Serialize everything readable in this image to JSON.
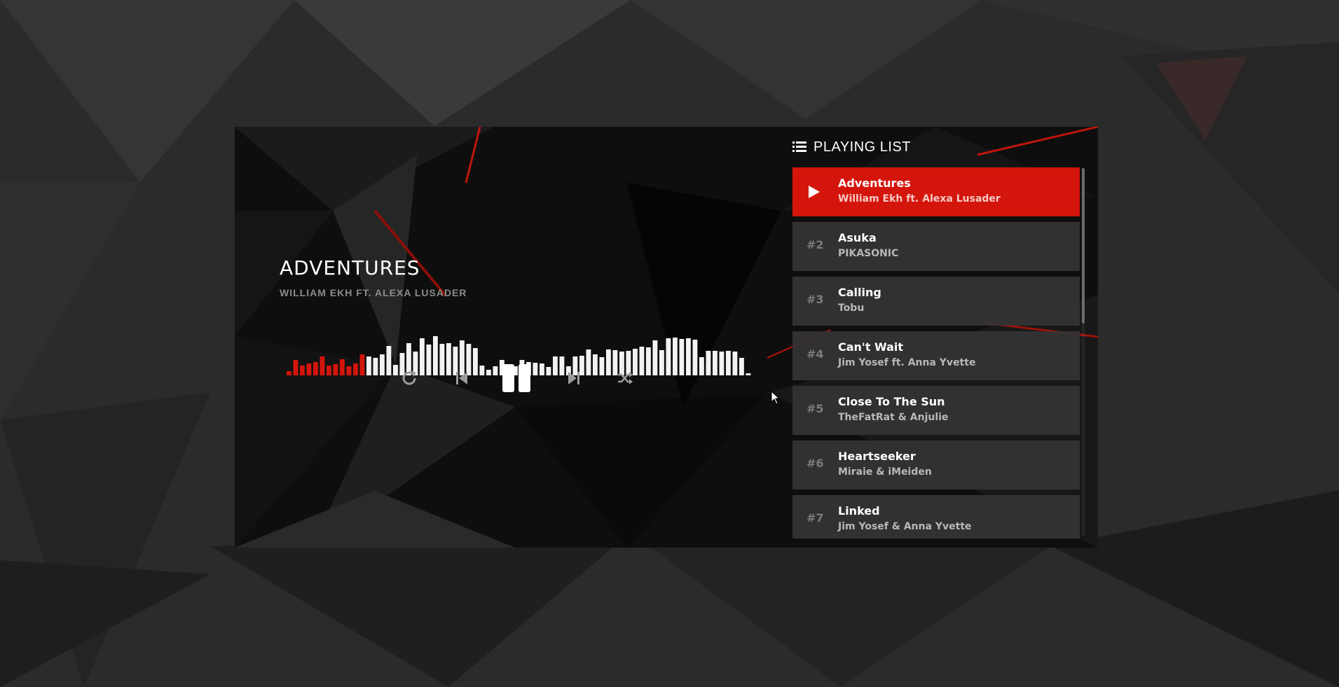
{
  "now_playing": {
    "title": "ADVENTURES",
    "artist": "WILLIAM EKH FT. ALEXA LUSADER",
    "progress": 0.17
  },
  "visualizer": {
    "levels": [
      6,
      22,
      14,
      17,
      19,
      27,
      14,
      16,
      23,
      13,
      17,
      30,
      27,
      25,
      30,
      42,
      15,
      32,
      46,
      34,
      53,
      44,
      56,
      45,
      46,
      41,
      50,
      45,
      39,
      14,
      8,
      13,
      22,
      12,
      13,
      22,
      19,
      18,
      17,
      12,
      27,
      27,
      13,
      27,
      28,
      37,
      30,
      26,
      37,
      36,
      34,
      35,
      38,
      41,
      40,
      50,
      36,
      53,
      54,
      52,
      53,
      51,
      26,
      35,
      35,
      34,
      35,
      34,
      25,
      3
    ],
    "played_color": "#d4150c",
    "unplayed_color": "#f2f2f2"
  },
  "controls": {
    "repeat_icon": "repeat-icon",
    "prev_icon": "skip-back-icon",
    "pause_icon": "pause-icon",
    "next_icon": "skip-forward-icon",
    "shuffle_icon": "shuffle-icon"
  },
  "playlist": {
    "heading": "PLAYING LIST",
    "heading_icon": "list-icon",
    "items": [
      {
        "number": "",
        "name": "Adventures",
        "artist": "William Ekh ft. Alexa Lusader",
        "active": true
      },
      {
        "number": "#2",
        "name": "Asuka",
        "artist": "PIKASONIC",
        "active": false
      },
      {
        "number": "#3",
        "name": "Calling",
        "artist": "Tobu",
        "active": false
      },
      {
        "number": "#4",
        "name": "Can't Wait",
        "artist": "Jim Yosef ft. Anna Yvette",
        "active": false
      },
      {
        "number": "#5",
        "name": "Close To The Sun",
        "artist": "TheFatRat & Anjulie",
        "active": false
      },
      {
        "number": "#6",
        "name": "Heartseeker",
        "artist": "Miraie & iMeiden",
        "active": false
      },
      {
        "number": "#7",
        "name": "Linked",
        "artist": "Jim Yosef & Anna Yvette",
        "active": false
      }
    ]
  },
  "colors": {
    "accent": "#d4150c",
    "item_bg": "#343434",
    "background": "#2a2a2a"
  }
}
